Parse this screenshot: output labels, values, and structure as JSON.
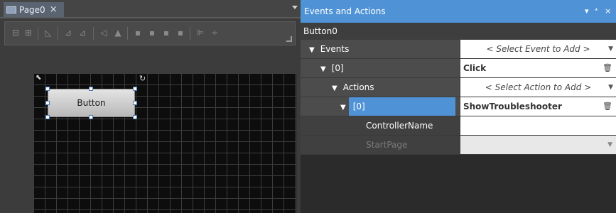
{
  "designer": {
    "tab_label": "Page0",
    "tab_close": "×",
    "button_label": "Button"
  },
  "panel": {
    "title": "Events and Actions",
    "controls": [
      "▾",
      "ᗮ",
      "×"
    ],
    "object_name": "Button0",
    "rows": [
      {
        "label": "Events",
        "value": "< Select Event to Add >"
      },
      {
        "label": "[0]",
        "value": "Click"
      },
      {
        "label": "Actions",
        "value": "< Select Action to Add >"
      },
      {
        "label": "[0]",
        "value": "ShowTroubleshooter"
      },
      {
        "label": "ControllerName",
        "value": ""
      },
      {
        "label": "StartPage",
        "value": ""
      }
    ]
  },
  "colors": {
    "accent": "#4f93d6",
    "canvas": "#0d0d0d",
    "grid": "#3c3c3c"
  }
}
